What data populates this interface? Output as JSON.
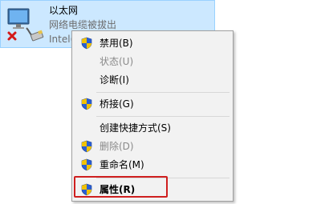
{
  "adapter": {
    "name": "以太网",
    "status": "网络电缆被拔出",
    "device": "Intel(",
    "icon": "network-adapter-disconnected-icon"
  },
  "context_menu": {
    "items": [
      {
        "label": "禁用(B)",
        "icon": "uac-shield-icon",
        "disabled": false,
        "bold": false
      },
      {
        "label": "状态(U)",
        "icon": null,
        "disabled": true,
        "bold": false
      },
      {
        "label": "诊断(I)",
        "icon": null,
        "disabled": false,
        "bold": false
      },
      {
        "label": "桥接(G)",
        "icon": "uac-shield-icon",
        "disabled": false,
        "bold": false
      },
      {
        "label": "创建快捷方式(S)",
        "icon": null,
        "disabled": false,
        "bold": false
      },
      {
        "label": "删除(D)",
        "icon": "uac-shield-icon",
        "disabled": true,
        "bold": false
      },
      {
        "label": "重命名(M)",
        "icon": "uac-shield-icon",
        "disabled": false,
        "bold": false
      },
      {
        "label": "属性(R)",
        "icon": "uac-shield-icon",
        "disabled": false,
        "bold": true
      }
    ]
  },
  "colors": {
    "selection_bg": "#cce8ff",
    "menu_bg": "#f2f2f2",
    "highlight_border": "#cf1f1f",
    "disabled_text": "#8a8a8a"
  }
}
